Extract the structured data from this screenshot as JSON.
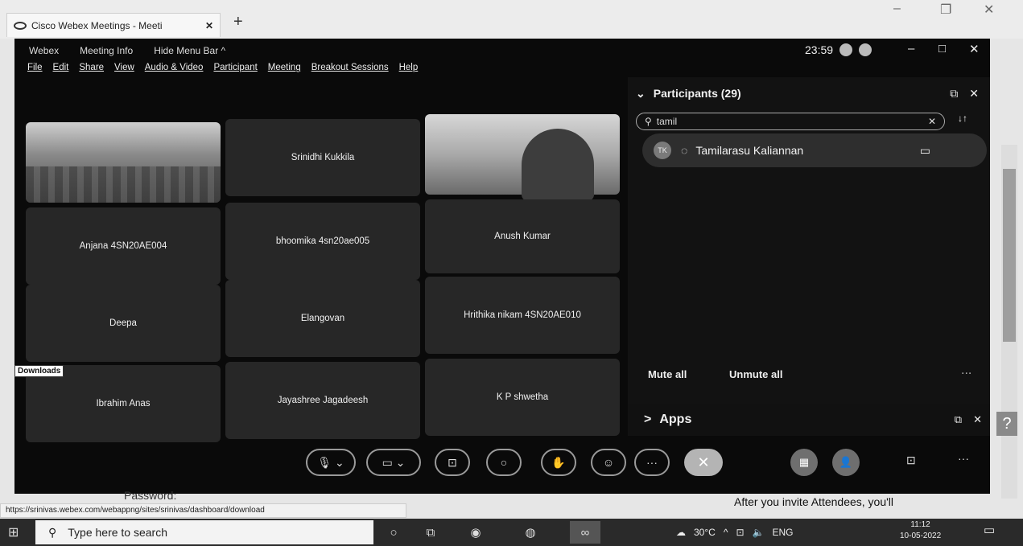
{
  "browser": {
    "tab_title": "Cisco Webex Meetings - Meeti",
    "new_tab_symbol": "+",
    "tab_close_symbol": "✕"
  },
  "webex": {
    "titlebar": {
      "app": "Webex",
      "meeting_info": "Meeting Info",
      "hide_menu": "Hide Menu Bar ^"
    },
    "clock": "23:59",
    "menu": [
      "File",
      "Edit",
      "Share",
      "View",
      "Audio & Video",
      "Participant",
      "Meeting",
      "Breakout Sessions",
      "Help"
    ],
    "tiles": [
      {
        "name": ""
      },
      {
        "name": "Srinidhi Kukkila"
      },
      {
        "name": ""
      },
      {
        "name": "Anjana 4SN20AE004"
      },
      {
        "name": "bhoomika 4sn20ae005"
      },
      {
        "name": "Anush Kumar"
      },
      {
        "name": "Deepa"
      },
      {
        "name": "Elangovan"
      },
      {
        "name": "Hrithika nikam 4SN20AE010"
      },
      {
        "name": "Ibrahim Anas"
      },
      {
        "name": "Jayashree Jagadeesh"
      },
      {
        "name": "K P shwetha"
      }
    ],
    "participants": {
      "title": "Participants (29)",
      "search_value": "tamil",
      "sort_symbol": "↓↑",
      "row": {
        "initials": "TK",
        "name": "Tamilarasu Kaliannan"
      },
      "mute_all": "Mute all",
      "unmute_all": "Unmute all",
      "more": "..."
    },
    "apps": {
      "label": "Apps",
      "chevron": ">"
    }
  },
  "tooltip": "Downloads",
  "page": {
    "password_label": "Password:",
    "invite_text": "After you invite Attendees, you'll",
    "status_url": "https://srinivas.webex.com/webappng/sites/srinivas/dashboard/download",
    "help_symbol": "?"
  },
  "taskbar": {
    "search_placeholder": "Type here to search",
    "temperature": "30°C",
    "lang": "ENG",
    "time": "11:12",
    "date": "10-05-2022"
  }
}
